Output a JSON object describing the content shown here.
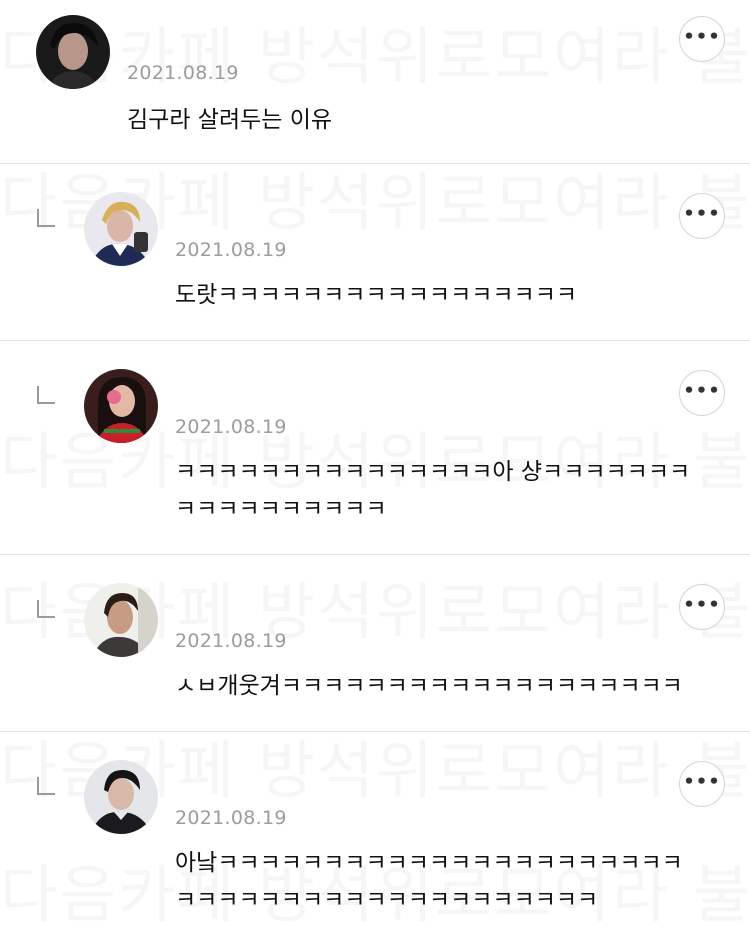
{
  "comments": [
    {
      "date": "2021.08.19",
      "text": "김구라 살려두는 이유",
      "is_reply": false,
      "avatar_icon": "user-avatar-icon",
      "more_icon": "more-options-icon"
    },
    {
      "date": "2021.08.19",
      "text": "도랏ㅋㅋㅋㅋㅋㅋㅋㅋㅋㅋㅋㅋㅋㅋㅋㅋㅋ",
      "is_reply": true,
      "avatar_icon": "user-avatar-icon",
      "more_icon": "more-options-icon"
    },
    {
      "date": "2021.08.19",
      "text": "ㅋㅋㅋㅋㅋㅋㅋㅋㅋㅋㅋㅋㅋㅋㅋ아 샹ㅋㅋㅋㅋㅋㅋㅋ\nㅋㅋㅋㅋㅋㅋㅋㅋㅋㅋ",
      "is_reply": true,
      "avatar_icon": "user-avatar-icon",
      "more_icon": "more-options-icon"
    },
    {
      "date": "2021.08.19",
      "text": "ㅅㅂ개웃겨ㅋㅋㅋㅋㅋㅋㅋㅋㅋㅋㅋㅋㅋㅋㅋㅋㅋㅋㅋ",
      "is_reply": true,
      "avatar_icon": "user-avatar-icon",
      "more_icon": "more-options-icon"
    },
    {
      "date": "2021.08.19",
      "text": "아낰ㅋㅋㅋㅋㅋㅋㅋㅋㅋㅋㅋㅋㅋㅋㅋㅋㅋㅋㅋㅋㅋㅋ\nㅋㅋㅋㅋㅋㅋㅋㅋㅋㅋㅋㅋㅋㅋㅋㅋㅋㅋㅋㅋ",
      "is_reply": true,
      "avatar_icon": "user-avatar-icon",
      "more_icon": "more-options-icon"
    }
  ],
  "watermark": "다음카페 방석위로모여라 불펌금지",
  "colors": {
    "date": "#9c9c9c",
    "text": "#111111",
    "divider": "#e2e2e2"
  }
}
